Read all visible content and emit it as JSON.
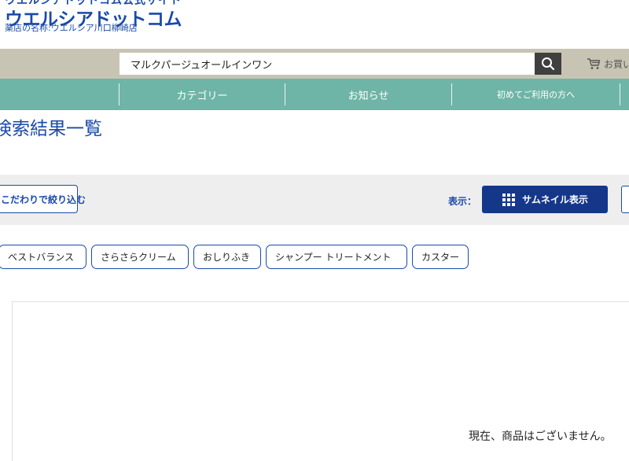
{
  "logo": {
    "top_text": "ウエルシアドットコム公式サイト",
    "main_text": "ウエルシアドットコム",
    "sub_text": "薬店の名称:ウエルシア川口柳崎店"
  },
  "search": {
    "value": "マルクパージュオールインワン",
    "icon": "search-icon"
  },
  "cart": {
    "label": "お買い物カゴ",
    "icon": "cart-icon"
  },
  "nav": {
    "items": [
      {
        "label": "カテゴリー"
      },
      {
        "label": "お知らせ"
      },
      {
        "label": "初めてご利用の方へ"
      }
    ]
  },
  "heading": "検索結果一覧",
  "toolbar": {
    "filter_label": "こだわりで絞り込む",
    "display_label": "表示：",
    "thumbnail_label": "サムネイル表示",
    "icons": {
      "filter": "chevron-down-icon",
      "thumbnail": "grid-icon"
    }
  },
  "tags": [
    {
      "label": "ベストバランス"
    },
    {
      "label": "さらさらクリーム"
    },
    {
      "label": "おしりふき"
    },
    {
      "label": "シャンプー トリートメント"
    },
    {
      "label": "カスター"
    }
  ],
  "results": {
    "empty_message": "現在、商品はございません。"
  },
  "colors": {
    "brand_blue": "#1a4aa8",
    "nav_green": "#6fb5a7",
    "search_band": "#c8c4b3",
    "thumb_button": "#15378a"
  }
}
